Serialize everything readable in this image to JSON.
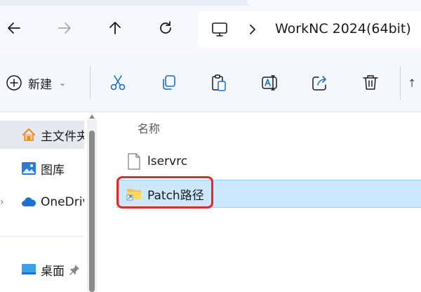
{
  "address_bar": {
    "crumb": "WorkNC 2024(64bit)"
  },
  "nav": {
    "back_icon": "back-arrow-icon",
    "forward_icon": "forward-arrow-icon",
    "up_icon": "up-arrow-icon",
    "refresh_icon": "refresh-icon"
  },
  "command_bar": {
    "new_label": "新建",
    "new_chevron": "⌄",
    "tools": [
      "cut-icon",
      "copy-icon",
      "paste-icon",
      "rename-icon",
      "share-icon",
      "delete-icon"
    ]
  },
  "sidebar": {
    "items": [
      {
        "label": "主文件夹",
        "icon": "home-icon",
        "selected": true
      },
      {
        "label": "图库",
        "icon": "gallery-icon"
      },
      {
        "label": "OneDrive",
        "icon": "cloud-icon",
        "expand": "›"
      },
      {
        "label": "桌面",
        "icon": "desktop-icon",
        "pinned": true
      }
    ]
  },
  "file_list": {
    "column_header": "名称",
    "rows": [
      {
        "name": "lservrc",
        "type": "file"
      },
      {
        "name": "Patch路径",
        "type": "folder-shortcut",
        "selected": true
      }
    ]
  },
  "colors": {
    "selection": "#cce8ff",
    "highlight_border": "#e02a2a",
    "accent": "#0078d4"
  }
}
